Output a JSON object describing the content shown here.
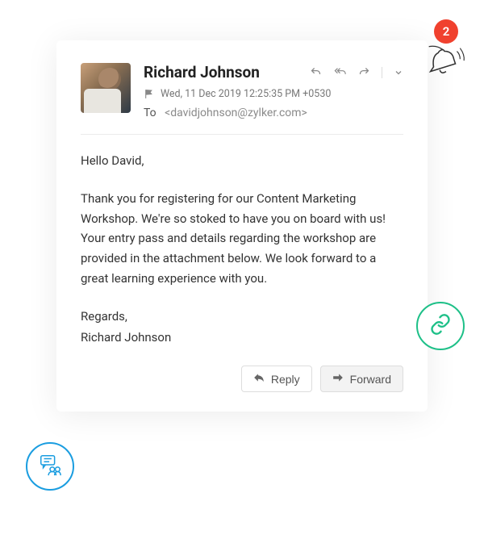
{
  "notification": {
    "count": "2"
  },
  "email": {
    "sender_name": "Richard Johnson",
    "date": "Wed, 11 Dec 2019 12:25:35 PM +0530",
    "to_label": "To",
    "recipient": "<davidjohnson@zylker.com>",
    "greeting": "Hello David,",
    "body": "Thank you for registering for our Content Marketing Workshop. We're so stoked to have you on board with us! Your entry pass and details regarding the workshop are provided in the attachment below. We look forward to a great learning experience with you.",
    "closing": "Regards,",
    "signature": "Richard Johnson"
  },
  "buttons": {
    "reply": "Reply",
    "forward": "Forward"
  }
}
